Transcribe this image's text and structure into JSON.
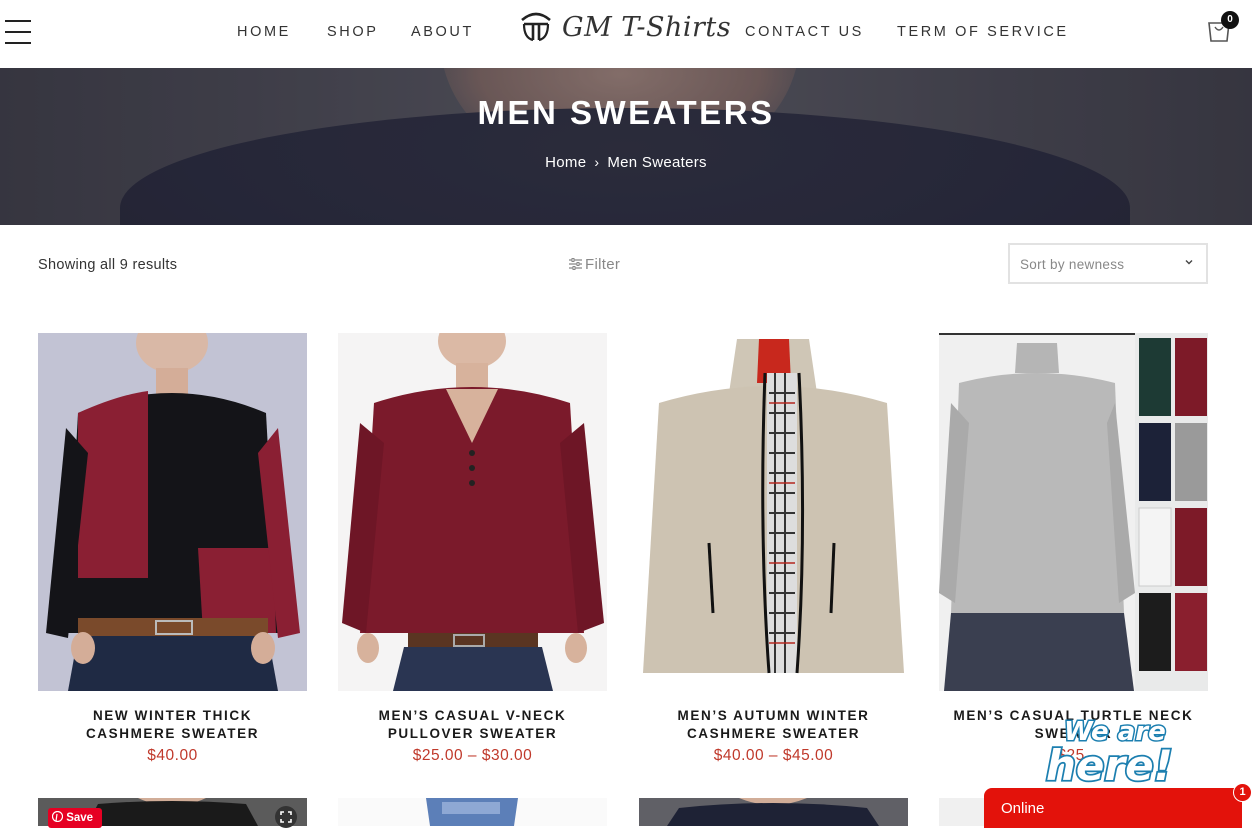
{
  "header": {
    "nav": [
      {
        "label": "HOME"
      },
      {
        "label": "SHOP"
      },
      {
        "label": "ABOUT"
      },
      {
        "label": "CONTACT US"
      },
      {
        "label": "TERM OF SERVICE"
      }
    ],
    "logo_text": "GM T-Shirts",
    "cart_count": "0"
  },
  "hero": {
    "title": "MEN SWEATERS",
    "breadcrumb": {
      "home": "Home",
      "separator": "›",
      "current": "Men Sweaters"
    }
  },
  "toolbar": {
    "results": "Showing all 9 results",
    "filter_label": "Filter",
    "sort_value": "Sort by newness"
  },
  "products": [
    {
      "name_line1": "NEW WINTER THICK",
      "name_line2": "CASHMERE SWEATER",
      "price": "$40.00"
    },
    {
      "name_line1": "MEN’S CASUAL V-NECK",
      "name_line2": "PULLOVER SWEATER",
      "price": "$25.00 – $30.00"
    },
    {
      "name_line1": "MEN’S AUTUMN WINTER",
      "name_line2": "CASHMERE SWEATER",
      "price": "$40.00 – $45.00"
    },
    {
      "name_line1": "MEN’S CASUAL TURTLE NECK",
      "name_line2": "SWEATER",
      "price": "$25."
    }
  ],
  "pinterest": {
    "save_label": "Save"
  },
  "chat": {
    "status": "Online",
    "badge": "1",
    "bubble_line1": "We are",
    "bubble_line2": "here!"
  },
  "colors": {
    "price": "#c0392b",
    "chat": "#e3120b",
    "pinterest": "#e60023"
  }
}
